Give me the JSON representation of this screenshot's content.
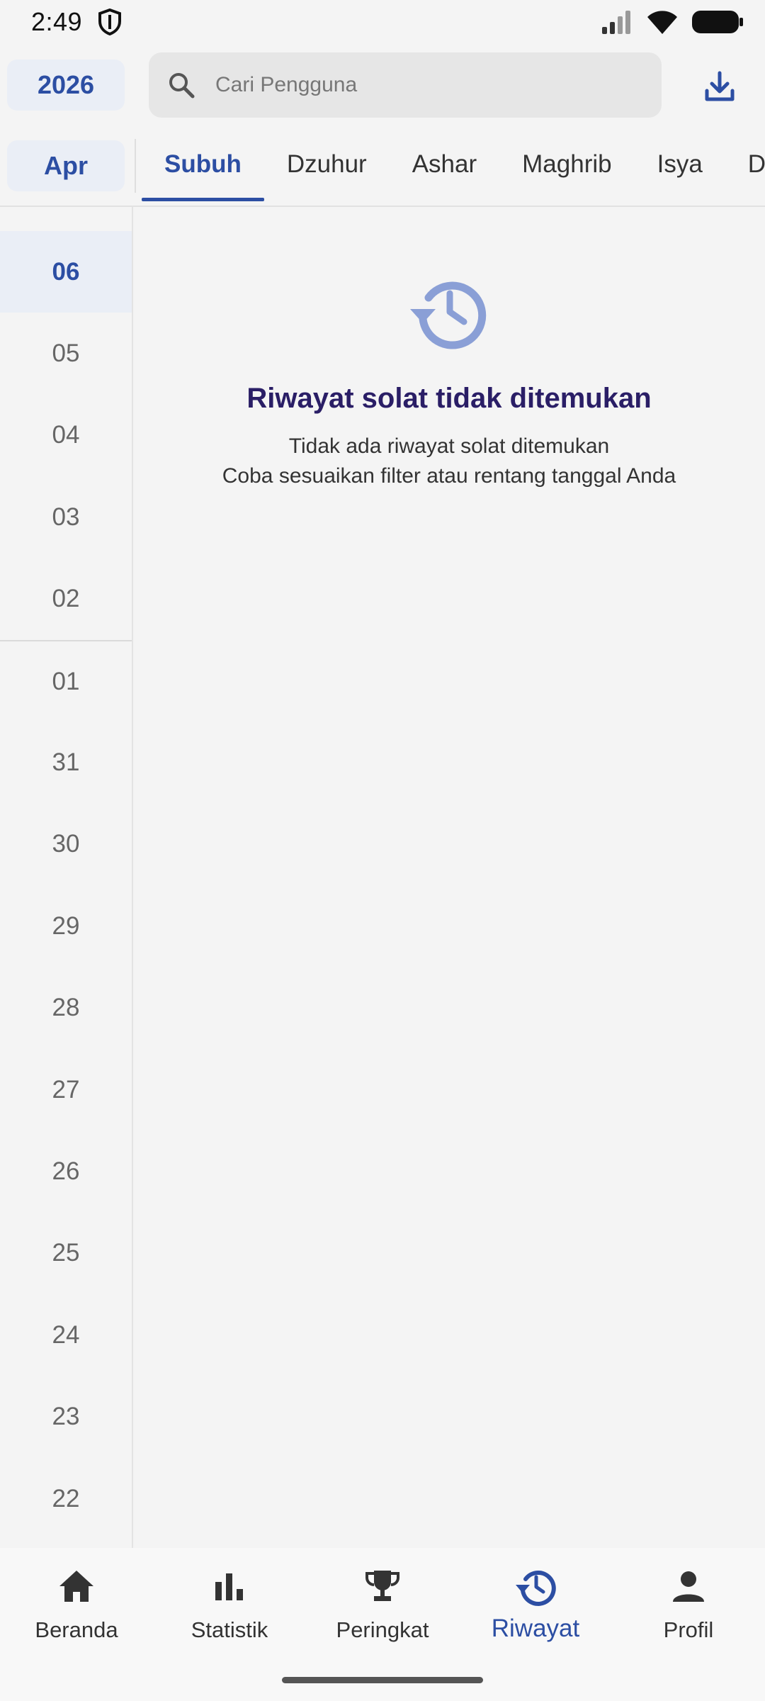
{
  "status_bar": {
    "time": "2:49"
  },
  "header": {
    "year": "2026",
    "search_placeholder": "Cari Pengguna"
  },
  "filters": {
    "month": "Apr",
    "tabs": [
      {
        "label": "Subuh",
        "active": true
      },
      {
        "label": "Dzuhur",
        "active": false
      },
      {
        "label": "Ashar",
        "active": false
      },
      {
        "label": "Maghrib",
        "active": false
      },
      {
        "label": "Isya",
        "active": false
      },
      {
        "label": "D",
        "active": false
      }
    ]
  },
  "dates": [
    "06",
    "05",
    "04",
    "03",
    "02",
    "01",
    "31",
    "30",
    "29",
    "28",
    "27",
    "26",
    "25",
    "24",
    "23",
    "22"
  ],
  "empty_state": {
    "title": "Riwayat solat tidak ditemukan",
    "line1": "Tidak ada riwayat solat ditemukan",
    "line2": "Coba sesuaikan filter atau rentang tanggal Anda"
  },
  "bottom_nav": [
    {
      "label": "Beranda",
      "icon": "home-icon"
    },
    {
      "label": "Statistik",
      "icon": "bar-chart-icon"
    },
    {
      "label": "Peringkat",
      "icon": "trophy-icon"
    },
    {
      "label": "Riwayat",
      "icon": "history-icon"
    },
    {
      "label": "Profil",
      "icon": "person-icon"
    }
  ],
  "colors": {
    "accent": "#2c4ea3",
    "title": "#2a1e66",
    "background": "#f4f4f4",
    "pill": "#eaeef6"
  }
}
